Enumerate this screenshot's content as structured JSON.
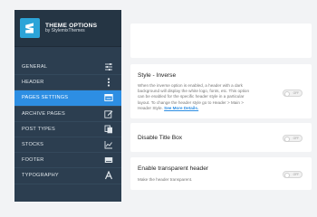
{
  "brand": {
    "title": "THEME OPTIONS",
    "subtitle": "by StylemixThemes",
    "logo_color": "#2ca4d8"
  },
  "sidebar": {
    "items": [
      {
        "label": "GENERAL",
        "icon": "sliders-icon"
      },
      {
        "label": "HEADER",
        "icon": "vertical-dots-icon"
      },
      {
        "label": "PAGES SETTINGS",
        "icon": "window-icon",
        "active": true
      },
      {
        "label": "ARCHIVE PAGES",
        "icon": "edit-icon"
      },
      {
        "label": "POST TYPES",
        "icon": "copy-icon"
      },
      {
        "label": "STOCKS",
        "icon": "chart-icon"
      },
      {
        "label": "FOOTER",
        "icon": "footer-icon"
      },
      {
        "label": "TYPOGRAPHY",
        "icon": "font-icon"
      }
    ]
  },
  "settings": {
    "style_inverse": {
      "title": "Style - Inverse",
      "description": "When the inverse option is enabled, a header with a dark background will display the white logo, fonts, etc. This option can be enabled for the specific header style in a particular layout. To change the header style go to Header > Main > Header Style.",
      "link": "See More Details.",
      "toggle": "OFF"
    },
    "disable_title_box": {
      "title": "Disable Title Box",
      "toggle": "OFF"
    },
    "enable_transparent_header": {
      "title": "Enable transparent header",
      "description": "Make the header transparent.",
      "toggle": "OFF"
    }
  },
  "colors": {
    "sidebar_bg": "#2c3e50",
    "active_item": "#2d8ee3",
    "link": "#2d8ee3"
  }
}
